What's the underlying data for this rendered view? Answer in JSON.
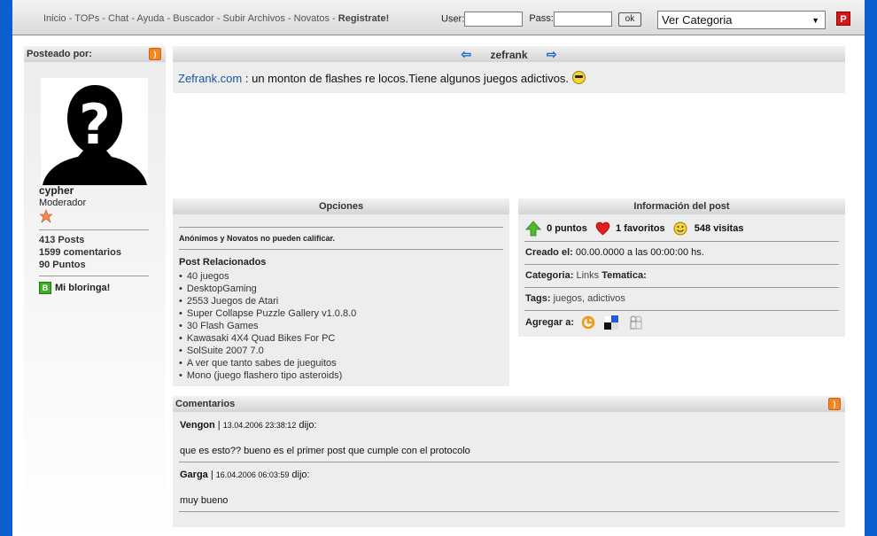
{
  "nav": {
    "items": [
      "Inicio",
      "TOPs",
      "Chat",
      "Ayuda",
      "Buscador",
      "Subir Archivos",
      "Novatos"
    ],
    "register": "Registrate!"
  },
  "login": {
    "user_label": "User:",
    "pass_label": "Pass:",
    "ok_label": "ok"
  },
  "category_select": {
    "value": "Ver Categoria"
  },
  "sidebar": {
    "header": "Posteado por:",
    "username": "cypher",
    "rank": "Moderador",
    "posts": "413 Posts",
    "comments": "1599 comentarios",
    "points": "90 Puntos",
    "blog_label": "Mi bloringa!"
  },
  "post": {
    "title": "zefrank",
    "link_text": "Zefrank.com",
    "text": " : un monton de flashes re locos.Tiene algunos juegos adictivos."
  },
  "options": {
    "header": "Opciones",
    "notice": "Anónimos y Novatos no pueden calificar.",
    "related_title": "Post Relacionados",
    "related": [
      "40 juegos",
      "DesktopGaming",
      "2553 Juegos de Atari",
      "Super Collapse Puzzle Gallery v1.0.8.0",
      "30 Flash Games",
      "Kawasaki 4X4 Quad Bikes For PC",
      "SolSuite 2007 7.0",
      "A ver que tanto sabes de jueguitos",
      "Mono (juego flashero tipo asteroids)"
    ]
  },
  "info": {
    "header": "Información del post",
    "points": "0 puntos",
    "favorites": "1 favoritos",
    "visits": "548 visitas",
    "created_label": "Creado el:",
    "created_value": " 00.00.0000 a las 00:00:00 hs.",
    "category_label": "Categoria:",
    "category_value": " Links ",
    "tematica_label": "Tematica:",
    "tags_label": "Tags:",
    "tags_value": " juegos, adictivos",
    "add_label": "Agregar a:"
  },
  "comments": {
    "header": "Comentarios",
    "items": [
      {
        "author": "Vengon",
        "sep": " | ",
        "date": "13.04.2006 23:38:12",
        "said": " dijo:",
        "text": "que es esto?? bueno es el primer post que cumple con el protocolo"
      },
      {
        "author": "Garga",
        "sep": " | ",
        "date": "16.04.2006 06:03:59",
        "said": " dijo:",
        "text": "muy bueno"
      }
    ]
  },
  "colors": {
    "background": "#0b5fd1",
    "link": "#1655a8",
    "rss": "#f4861f"
  }
}
